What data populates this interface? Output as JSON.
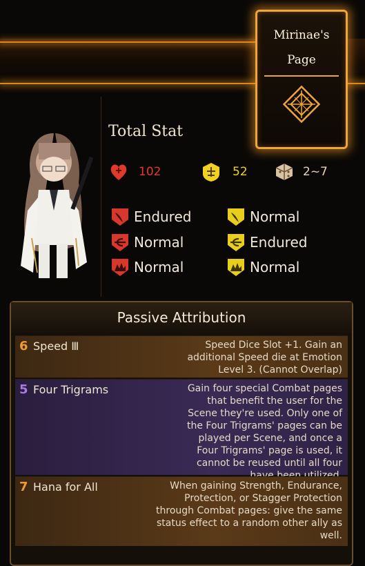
{
  "page": {
    "title_line1": "Mirinae's",
    "title_line2": "Page"
  },
  "total_stat": {
    "label": "Total Stat",
    "hp": "102",
    "stagger": "52",
    "speed": "2~7"
  },
  "resistances": {
    "physical": [
      {
        "type": "slash",
        "value": "Endured"
      },
      {
        "type": "pierce",
        "value": "Normal"
      },
      {
        "type": "blunt",
        "value": "Normal"
      }
    ],
    "stagger": [
      {
        "type": "slash",
        "value": "Normal"
      },
      {
        "type": "pierce",
        "value": "Endured"
      },
      {
        "type": "blunt",
        "value": "Normal"
      }
    ]
  },
  "passives": {
    "header": "Passive Attribution",
    "items": [
      {
        "cost": "6",
        "name": "Speed Ⅲ",
        "description": "Speed Dice Slot +1. Gain an additional Speed die at Emotion Level 3. (Cannot Overlap)",
        "color": "#e8932e"
      },
      {
        "cost": "5",
        "name": "Four Trigrams",
        "description": "Gain four special Combat pages that benefit the user for the Scene they're used. Only one of the Four Trigrams' pages can be played per Scene, and once a Four Trigrams' page is used, it cannot be reused until all four have been utilized.",
        "color": "#a77de3"
      },
      {
        "cost": "7",
        "name": "Hana for All",
        "description": "When gaining Strength, Endurance, Protection, or Stagger Protection through Combat pages: give the same status effect to a random other ally as well.",
        "color": "#e8932e"
      }
    ]
  },
  "colors": {
    "accent": "#f0a53a",
    "hp_red": "#e0392c",
    "stagger_yellow": "#f2d21e"
  }
}
